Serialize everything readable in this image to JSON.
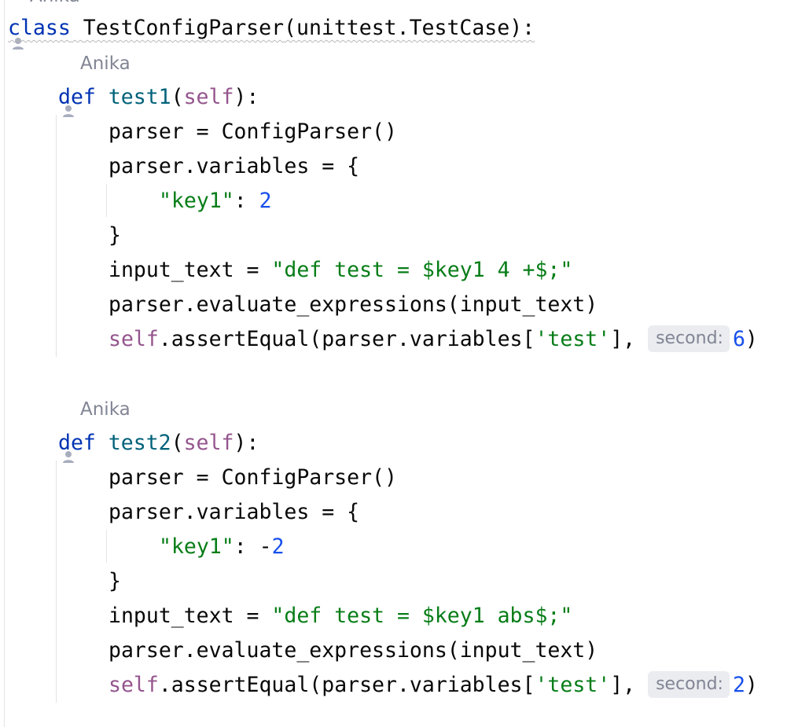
{
  "author_top": "Anika",
  "class_line": {
    "keyword": "class",
    "name": "TestConfigParser",
    "args": "(unittest.TestCase):"
  },
  "test1": {
    "author": "Anika",
    "def_kw": "def",
    "name": "test1",
    "self": "self",
    "line1": "parser = ConfigParser()",
    "line2": "parser.variables = {",
    "key": "\"key1\"",
    "colon": ": ",
    "value": "2",
    "close": "}",
    "input_lhs": "input_text = ",
    "input_str": "\"def test = $key1 4 +$;\"",
    "evaluate": "parser.evaluate_expressions(input_text)",
    "assert_self": "self",
    "assert_call": ".assertEqual(parser.variables[",
    "assert_key": "'test'",
    "assert_tail": "], ",
    "hint": "second:",
    "expected": "6",
    "close_paren": ")"
  },
  "test2": {
    "author": "Anika",
    "def_kw": "def",
    "name": "test2",
    "self": "self",
    "line1": "parser = ConfigParser()",
    "line2": "parser.variables = {",
    "key": "\"key1\"",
    "colon": ": ",
    "minus": "-",
    "value": "2",
    "close": "}",
    "input_lhs": "input_text = ",
    "input_str": "\"def test = $key1 abs$;\"",
    "evaluate": "parser.evaluate_expressions(input_text)",
    "assert_self": "self",
    "assert_call": ".assertEqual(parser.variables[",
    "assert_key": "'test'",
    "assert_tail": "], ",
    "hint": "second:",
    "expected": "2",
    "close_paren": ")"
  },
  "colors": {
    "keyword": "#0033b3",
    "function": "#00627a",
    "self": "#94558d",
    "string": "#067d17",
    "number": "#1750eb",
    "hint_bg": "#ebecf0",
    "hint_text": "#818594"
  }
}
